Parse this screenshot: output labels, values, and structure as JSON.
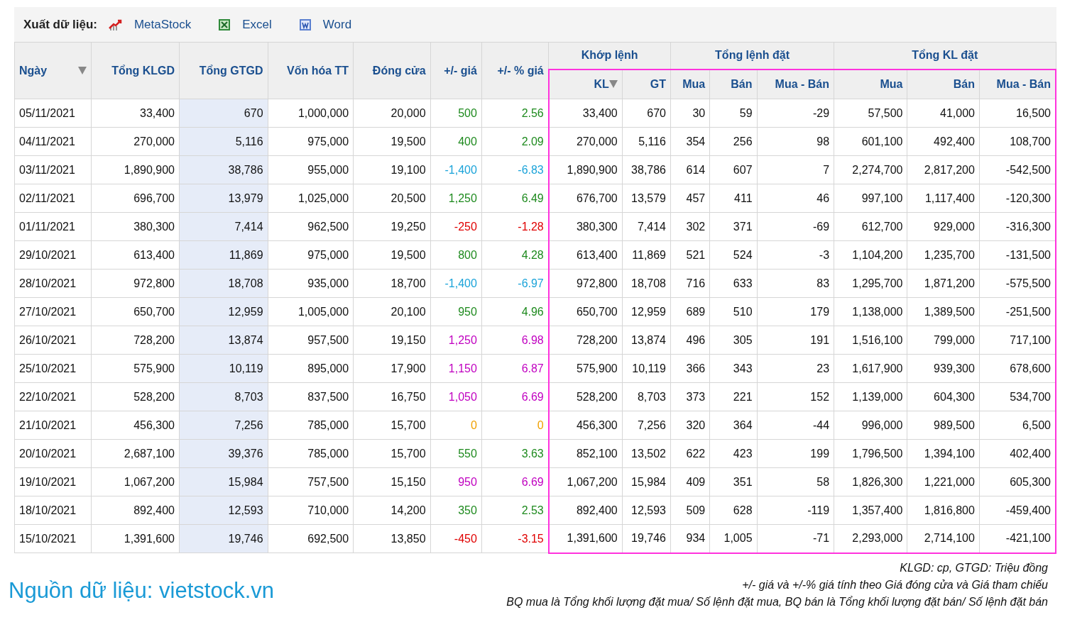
{
  "export_bar": {
    "label": "Xuất dữ liệu:",
    "links": [
      {
        "kind": "metastock",
        "label": "MetaStock"
      },
      {
        "kind": "excel",
        "label": "Excel"
      },
      {
        "kind": "word",
        "label": "Word"
      }
    ]
  },
  "table": {
    "columns": [
      {
        "label": "Ngày",
        "sorted": true,
        "shaded": false,
        "kind": "text"
      },
      {
        "label": "Tổng KLGD",
        "sorted": false,
        "shaded": false,
        "kind": "number"
      },
      {
        "label": "Tổng GTGD",
        "sorted": false,
        "shaded": true,
        "kind": "number"
      },
      {
        "label": "Vốn hóa TT",
        "sorted": false,
        "shaded": false,
        "kind": "number"
      },
      {
        "label": "Đóng cửa",
        "sorted": false,
        "shaded": false,
        "kind": "number"
      },
      {
        "label": "+/- giá",
        "sorted": false,
        "shaded": false,
        "kind": "number"
      },
      {
        "label": "+/- % giá",
        "sorted": false,
        "shaded": false,
        "kind": "number"
      }
    ],
    "groups": [
      {
        "label": "Khớp lệnh",
        "columns": [
          {
            "label": "KL",
            "sorted": true,
            "highlighted": true
          },
          {
            "label": "GT",
            "sorted": false,
            "highlighted": true
          }
        ]
      },
      {
        "label": "Tổng lệnh đặt",
        "columns": [
          {
            "label": "Mua",
            "sorted": false,
            "highlighted": true
          },
          {
            "label": "Bán",
            "sorted": false,
            "highlighted": true
          },
          {
            "label": "Mua - Bán",
            "sorted": false,
            "highlighted": true
          }
        ]
      },
      {
        "label": "Tổng KL đặt",
        "columns": [
          {
            "label": "Mua",
            "sorted": false,
            "highlighted": true
          },
          {
            "label": "Bán",
            "sorted": false,
            "highlighted": true
          },
          {
            "label": "Mua - Bán",
            "sorted": false,
            "highlighted": true
          }
        ]
      }
    ],
    "rows": [
      {
        "kind": "up",
        "cells": [
          "05/11/2021",
          "33,400",
          "670",
          "1,000,000",
          "20,000",
          "500",
          "2.56",
          "33,400",
          "670",
          "30",
          "59",
          "-29",
          "57,500",
          "41,000",
          "16,500"
        ]
      },
      {
        "kind": "up",
        "cells": [
          "04/11/2021",
          "270,000",
          "5,116",
          "975,000",
          "19,500",
          "400",
          "2.09",
          "270,000",
          "5,116",
          "354",
          "256",
          "98",
          "601,100",
          "492,400",
          "108,700"
        ]
      },
      {
        "kind": "floor",
        "cells": [
          "03/11/2021",
          "1,890,900",
          "38,786",
          "955,000",
          "19,100",
          "-1,400",
          "-6.83",
          "1,890,900",
          "38,786",
          "614",
          "607",
          "7",
          "2,274,700",
          "2,817,200",
          "-542,500"
        ]
      },
      {
        "kind": "up",
        "cells": [
          "02/11/2021",
          "696,700",
          "13,979",
          "1,025,000",
          "20,500",
          "1,250",
          "6.49",
          "676,700",
          "13,579",
          "457",
          "411",
          "46",
          "997,100",
          "1,117,400",
          "-120,300"
        ]
      },
      {
        "kind": "down",
        "cells": [
          "01/11/2021",
          "380,300",
          "7,414",
          "962,500",
          "19,250",
          "-250",
          "-1.28",
          "380,300",
          "7,414",
          "302",
          "371",
          "-69",
          "612,700",
          "929,000",
          "-316,300"
        ]
      },
      {
        "kind": "up",
        "cells": [
          "29/10/2021",
          "613,400",
          "11,869",
          "975,000",
          "19,500",
          "800",
          "4.28",
          "613,400",
          "11,869",
          "521",
          "524",
          "-3",
          "1,104,200",
          "1,235,700",
          "-131,500"
        ]
      },
      {
        "kind": "floor",
        "cells": [
          "28/10/2021",
          "972,800",
          "18,708",
          "935,000",
          "18,700",
          "-1,400",
          "-6.97",
          "972,800",
          "18,708",
          "716",
          "633",
          "83",
          "1,295,700",
          "1,871,200",
          "-575,500"
        ]
      },
      {
        "kind": "up",
        "cells": [
          "27/10/2021",
          "650,700",
          "12,959",
          "1,005,000",
          "20,100",
          "950",
          "4.96",
          "650,700",
          "12,959",
          "689",
          "510",
          "179",
          "1,138,000",
          "1,389,500",
          "-251,500"
        ]
      },
      {
        "kind": "ceiling",
        "cells": [
          "26/10/2021",
          "728,200",
          "13,874",
          "957,500",
          "19,150",
          "1,250",
          "6.98",
          "728,200",
          "13,874",
          "496",
          "305",
          "191",
          "1,516,100",
          "799,000",
          "717,100"
        ]
      },
      {
        "kind": "ceiling",
        "cells": [
          "25/10/2021",
          "575,900",
          "10,119",
          "895,000",
          "17,900",
          "1,150",
          "6.87",
          "575,900",
          "10,119",
          "366",
          "343",
          "23",
          "1,617,900",
          "939,300",
          "678,600"
        ]
      },
      {
        "kind": "ceiling",
        "cells": [
          "22/10/2021",
          "528,200",
          "8,703",
          "837,500",
          "16,750",
          "1,050",
          "6.69",
          "528,200",
          "8,703",
          "373",
          "221",
          "152",
          "1,139,000",
          "604,300",
          "534,700"
        ]
      },
      {
        "kind": "ref",
        "cells": [
          "21/10/2021",
          "456,300",
          "7,256",
          "785,000",
          "15,700",
          "0",
          "0",
          "456,300",
          "7,256",
          "320",
          "364",
          "-44",
          "996,000",
          "989,500",
          "6,500"
        ]
      },
      {
        "kind": "up",
        "cells": [
          "20/10/2021",
          "2,687,100",
          "39,376",
          "785,000",
          "15,700",
          "550",
          "3.63",
          "852,100",
          "13,502",
          "622",
          "423",
          "199",
          "1,796,500",
          "1,394,100",
          "402,400"
        ]
      },
      {
        "kind": "ceiling",
        "cells": [
          "19/10/2021",
          "1,067,200",
          "15,984",
          "757,500",
          "15,150",
          "950",
          "6.69",
          "1,067,200",
          "15,984",
          "409",
          "351",
          "58",
          "1,826,300",
          "1,221,000",
          "605,300"
        ]
      },
      {
        "kind": "up",
        "cells": [
          "18/10/2021",
          "892,400",
          "12,593",
          "710,000",
          "14,200",
          "350",
          "2.53",
          "892,400",
          "12,593",
          "509",
          "628",
          "-119",
          "1,357,400",
          "1,816,800",
          "-459,400"
        ]
      },
      {
        "kind": "down",
        "cells": [
          "15/10/2021",
          "1,391,600",
          "19,746",
          "692,500",
          "13,850",
          "-450",
          "-3.15",
          "1,391,600",
          "19,746",
          "934",
          "1,005",
          "-71",
          "2,293,000",
          "2,714,100",
          "-421,100"
        ]
      }
    ]
  },
  "source": "Nguồn dữ liệu: vietstock.vn",
  "notes": [
    "KLGD: cp, GTGD: Triệu đồng",
    "+/- giá và +/-% giá tính theo Giá đóng cửa và Giá tham chiếu",
    "BQ mua là Tổng khối lượng đặt mua/ Số lệnh đặt mua, BQ bán là Tổng khối lượng đặt bán/ Số lệnh đặt bán"
  ]
}
